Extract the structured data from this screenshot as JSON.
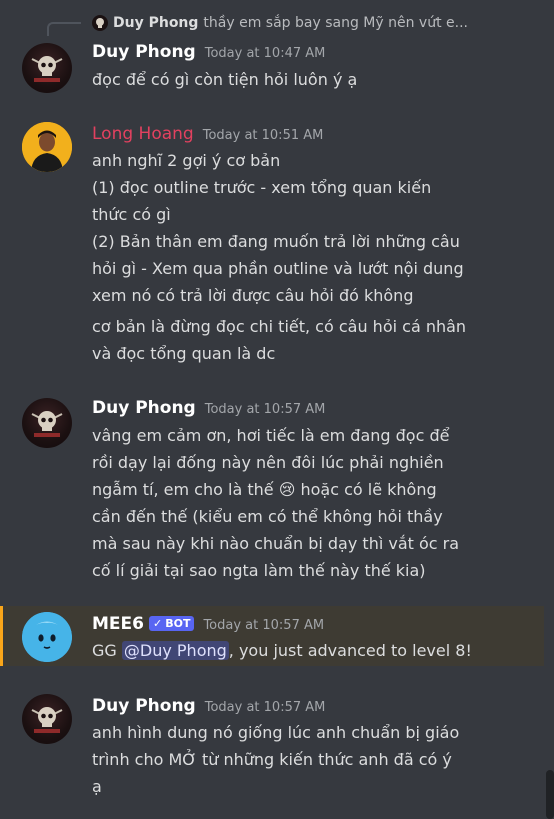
{
  "reply": {
    "author": "Duy Phong",
    "preview": "thầy em sắp bay sang Mỹ nên vứt e..."
  },
  "messages": [
    {
      "author": "Duy Phong",
      "time": "Today at 10:47 AM",
      "lines": [
        "đọc để có gì còn tiện hỏi luôn ý ạ"
      ]
    },
    {
      "author": "Long Hoang",
      "time": "Today at 10:51 AM",
      "lines": [
        "anh nghĩ 2 gợi ý cơ bản",
        "(1) đọc outline trước - xem tổng quan kiến",
        "thức có gì",
        "(2) Bản thân em đang muốn trả lời những câu",
        "hỏi gì - Xem qua phần outline và lướt nội dung",
        "xem nó có trả lời được câu hỏi đó không",
        "cơ bản là đừng đọc chi tiết, có câu hỏi cá nhân",
        "và đọc tổng quan là dc"
      ]
    },
    {
      "author": "Duy Phong",
      "time": "Today at 10:57 AM",
      "lines": [
        "vâng em cảm ơn, hơi tiếc là em đang đọc để",
        "rồi dạy lại đống này nên đôi lúc phải nghiền",
        "ngẫm tí, em cho là thế",
        "hoặc có lẽ không",
        "cần đến thế (kiểu em có thể không hỏi thầy",
        "mà sau này khi nào chuẩn bị dạy thì vắt óc ra",
        "cố lí giải tại sao ngta làm thế này thế kia)"
      ]
    },
    {
      "author": "MEE6",
      "bot_tag": "BOT",
      "time": "Today at 10:57 AM",
      "text_before": "GG ",
      "mention": "@Duy Phong",
      "text_after": ", you just advanced to level 8!"
    },
    {
      "author": "Duy Phong",
      "time": "Today at 10:57 AM",
      "lines": [
        "anh hình dung nó giống lúc anh chuẩn bị giáo",
        "trình cho MỞ từ những kiến thức anh đã có ý",
        "ạ"
      ]
    }
  ],
  "icons": {
    "crying_emoji": "😢",
    "verified_check": "✓"
  },
  "colors": {
    "background": "#36393f",
    "red_name": "#e2415f",
    "bot_tag": "#5865f2",
    "highlight_bar": "#faa61a"
  }
}
